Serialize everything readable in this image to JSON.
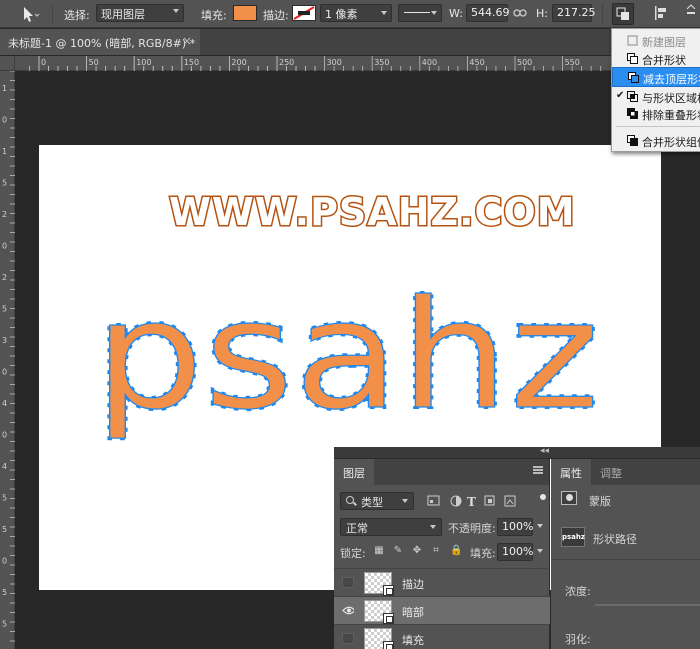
{
  "options_bar": {
    "select_label": "选择:",
    "select_value": "现用图层",
    "fill_label": "填充:",
    "fill_color": "#f2904a",
    "stroke_label": "描边:",
    "stroke_width": "1 像素",
    "w_label": "W:",
    "w_value": "544.69",
    "h_label": "H:",
    "h_value": "217.25"
  },
  "document_tab": {
    "title": "未标题-1 @ 100% (暗部, RGB/8#) *",
    "close": "×"
  },
  "rulers": {
    "horizontal": [
      "0",
      "50",
      "100",
      "150",
      "200",
      "250",
      "300",
      "350",
      "400",
      "450",
      "500",
      "550"
    ],
    "vertical": [
      "1",
      "0",
      "1",
      "5",
      "2",
      "0",
      "2",
      "5",
      "3",
      "0",
      "4",
      "0",
      "4",
      "5",
      "5",
      "0",
      "5",
      "5"
    ]
  },
  "canvas": {
    "watermark": "WWW.PSAHZ.COM",
    "big_text": "psahz",
    "text_fill": "#f2904a",
    "outline_color": "#1e88f0",
    "watermark_stroke": "#b5520f"
  },
  "path_ops_menu": {
    "items": [
      {
        "label": "新建图层",
        "checked": false,
        "disabled": true,
        "highlighted": false
      },
      {
        "label": "合并形状",
        "checked": false,
        "disabled": false,
        "highlighted": false
      },
      {
        "label": "减去顶层形状",
        "checked": false,
        "disabled": false,
        "highlighted": true
      },
      {
        "label": "与形状区域相交",
        "checked": true,
        "disabled": false,
        "highlighted": false
      },
      {
        "label": "排除重叠形状",
        "checked": false,
        "disabled": false,
        "highlighted": false
      },
      {
        "label": "合并形状组件",
        "checked": false,
        "disabled": false,
        "highlighted": false
      }
    ]
  },
  "layers_panel": {
    "tab_layers": "图层",
    "kind_filter": "类型",
    "blend_mode": "正常",
    "opacity_label": "不透明度:",
    "opacity_value": "100%",
    "lock_label": "锁定:",
    "fill_label": "填充:",
    "fill_value": "100%",
    "layers": [
      {
        "name": "描边",
        "visible": false,
        "selected": false
      },
      {
        "name": "暗部",
        "visible": true,
        "selected": true
      },
      {
        "name": "填充",
        "visible": false,
        "selected": false
      }
    ]
  },
  "properties_panel": {
    "tab_properties": "属性",
    "tab_adjust": "调整",
    "mask_label": "蒙版",
    "path_icon_text": "psahz",
    "shape_path_label": "形状路径",
    "density_label": "浓度:",
    "feather_label": "羽化:"
  }
}
